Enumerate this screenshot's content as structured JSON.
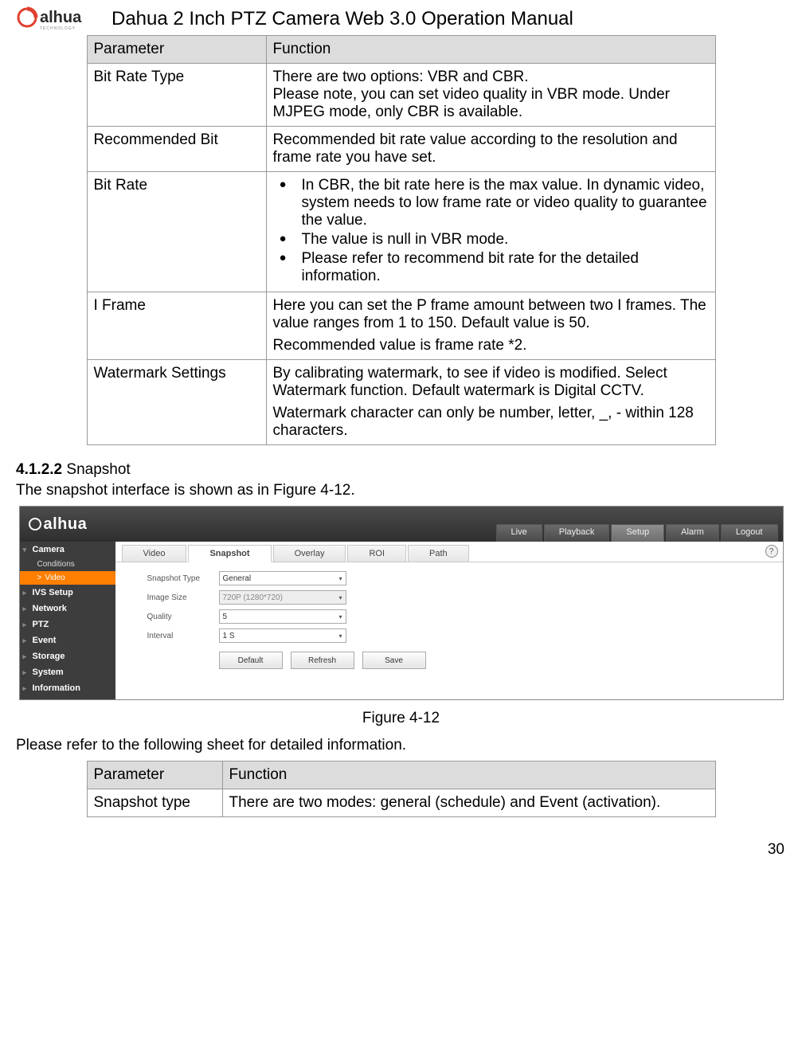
{
  "header": {
    "brand_main": "alhua",
    "brand_sub": "TECHNOLOGY",
    "title": "Dahua 2 Inch PTZ Camera Web 3.0 Operation Manual"
  },
  "table1": {
    "header": {
      "param": "Parameter",
      "func": "Function"
    },
    "rows": [
      {
        "param": "Bit Rate Type",
        "func_lines": [
          "There are two options: VBR and CBR.",
          "Please note, you can set video quality in VBR mode. Under MJPEG mode, only CBR is available."
        ]
      },
      {
        "param": "Recommended Bit",
        "func_lines": [
          "Recommended bit rate value according to the resolution and frame rate you have set."
        ]
      },
      {
        "param": "Bit Rate",
        "bullets": [
          "In CBR, the bit rate here is the max value.  In dynamic video, system needs to low frame rate or video quality to guarantee the value.",
          "The value is null in VBR mode.",
          "Please refer to recommend bit rate for the detailed information."
        ]
      },
      {
        "param": "I Frame",
        "func_lines": [
          "Here you can set the P frame amount between two I frames. The value ranges from 1 to 150.  Default value is 50.",
          "Recommended value is frame rate *2."
        ]
      },
      {
        "param": "Watermark Settings",
        "func_lines": [
          "By calibrating watermark, to see if video is modified. Select Watermark function. Default watermark is Digital CCTV.",
          "Watermark character can only be number, letter, _, - within 128 characters."
        ]
      }
    ]
  },
  "section": {
    "number": "4.1.2.2",
    "title": "Snapshot",
    "intro": "The snapshot interface is shown as in Figure 4-12."
  },
  "screenshot": {
    "brand": "alhua",
    "topnav": [
      "Live",
      "Playback",
      "Setup",
      "Alarm",
      "Logout"
    ],
    "topnav_active": "Setup",
    "sidebar": {
      "items": [
        {
          "label": "Camera",
          "expanded": true,
          "subs": [
            {
              "label": "Conditions"
            },
            {
              "label": "Video",
              "active": true
            }
          ]
        },
        {
          "label": "IVS Setup"
        },
        {
          "label": "Network"
        },
        {
          "label": "PTZ"
        },
        {
          "label": "Event"
        },
        {
          "label": "Storage"
        },
        {
          "label": "System"
        },
        {
          "label": "Information"
        }
      ]
    },
    "tabs": [
      "Video",
      "Snapshot",
      "Overlay",
      "ROI",
      "Path"
    ],
    "tabs_active": "Snapshot",
    "help_icon": "?",
    "form": {
      "rows": [
        {
          "label": "Snapshot Type",
          "value": "General",
          "disabled": false
        },
        {
          "label": "Image Size",
          "value": "720P (1280*720)",
          "disabled": true
        },
        {
          "label": "Quality",
          "value": "5",
          "disabled": false
        },
        {
          "label": "Interval",
          "value": "1 S",
          "disabled": false
        }
      ],
      "buttons": [
        "Default",
        "Refresh",
        "Save"
      ]
    }
  },
  "figure_caption": "Figure 4-12",
  "ref_text": "Please refer to the following sheet for detailed information.",
  "table2": {
    "header": {
      "param": "Parameter",
      "func": "Function"
    },
    "rows": [
      {
        "param": "Snapshot type",
        "func": "There are two modes: general (schedule) and Event (activation)."
      }
    ]
  },
  "page_number": "30"
}
